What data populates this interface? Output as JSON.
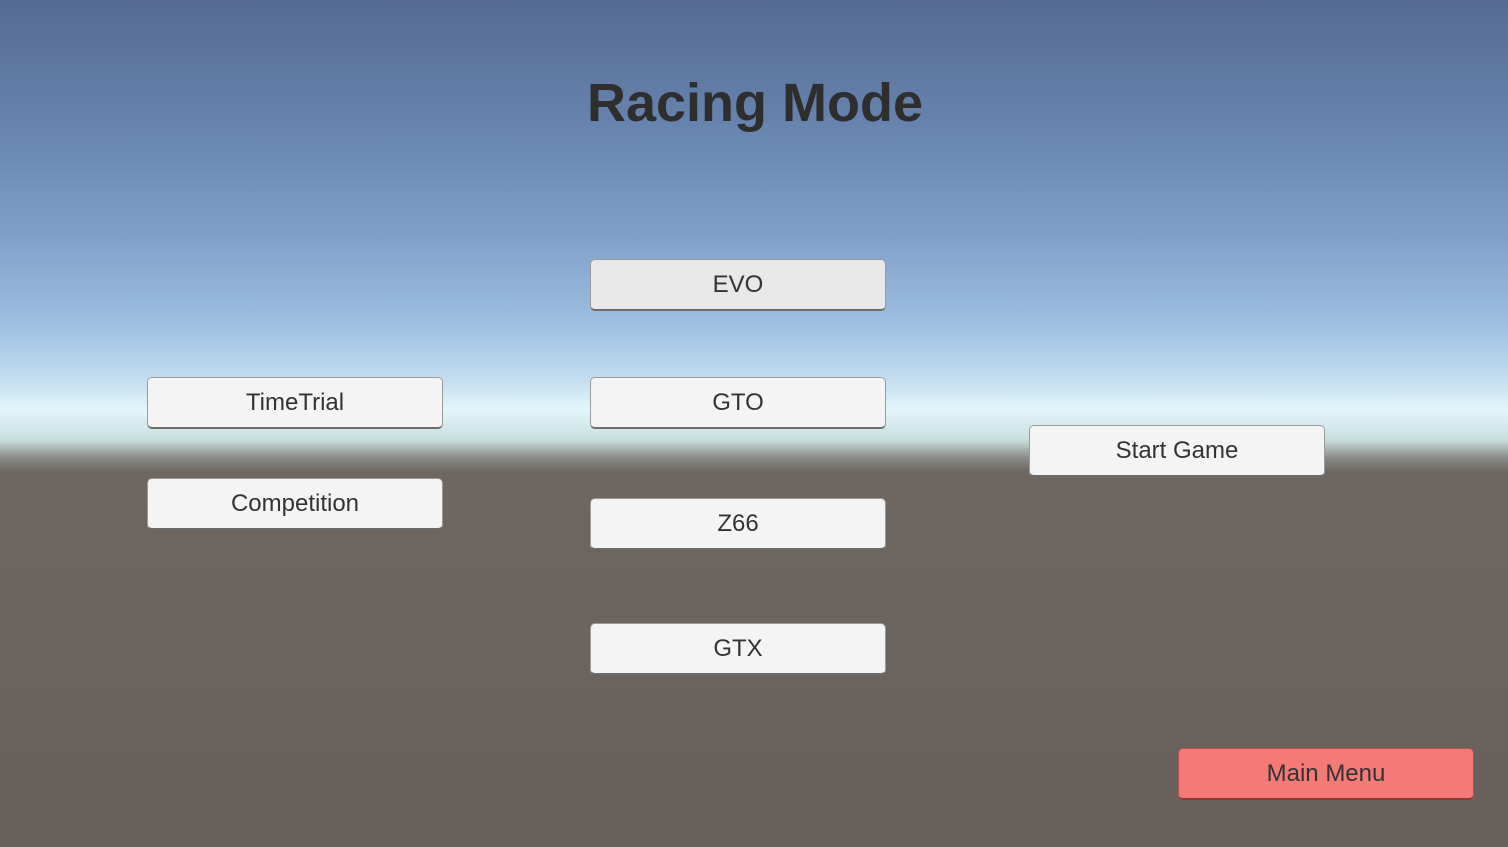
{
  "title": "Racing Mode",
  "modes": [
    {
      "label": "TimeTrial"
    },
    {
      "label": "Competition"
    }
  ],
  "cars": [
    {
      "label": "EVO"
    },
    {
      "label": "GTO"
    },
    {
      "label": "Z66"
    },
    {
      "label": "GTX"
    }
  ],
  "start_label": "Start Game",
  "main_menu_label": "Main Menu",
  "colors": {
    "main_menu": "#f47a78",
    "button": "#f4f4f4",
    "ground": "#67605b",
    "sky_top": "#556b93"
  }
}
